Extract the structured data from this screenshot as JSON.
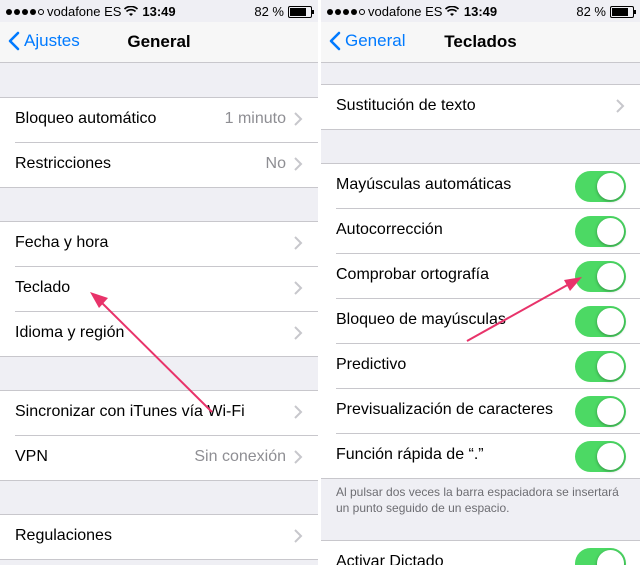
{
  "status_bar": {
    "carrier": "vodafone ES",
    "time": "13:49",
    "battery": "82 %",
    "battery_level_percent": 82
  },
  "left_screen": {
    "nav": {
      "back_label": "Ajustes",
      "title": "General"
    },
    "groups": [
      {
        "rows": [
          {
            "label": "Bloqueo automático",
            "value": "1 minuto"
          },
          {
            "label": "Restricciones",
            "value": "No"
          }
        ]
      },
      {
        "rows": [
          {
            "label": "Fecha y hora",
            "value": ""
          },
          {
            "label": "Teclado",
            "value": ""
          },
          {
            "label": "Idioma y región",
            "value": ""
          }
        ]
      },
      {
        "rows": [
          {
            "label": "Sincronizar con iTunes vía Wi-Fi",
            "value": ""
          },
          {
            "label": "VPN",
            "value": "Sin conexión"
          }
        ]
      },
      {
        "rows": [
          {
            "label": "Regulaciones",
            "value": ""
          }
        ]
      }
    ]
  },
  "right_screen": {
    "nav": {
      "back_label": "General",
      "title": "Teclados"
    },
    "groups": [
      {
        "rows": [
          {
            "label": "Sustitución de texto"
          }
        ]
      },
      {
        "rows": [
          {
            "label": "Mayúsculas automáticas",
            "on": true
          },
          {
            "label": "Autocorrección",
            "on": true
          },
          {
            "label": "Comprobar ortografía",
            "on": true
          },
          {
            "label": "Bloqueo de mayúsculas",
            "on": true
          },
          {
            "label": "Predictivo",
            "on": true
          },
          {
            "label": "Previsualización de caracteres",
            "on": true
          },
          {
            "label": "Función rápida de “.”",
            "on": true
          }
        ]
      },
      {
        "rows": [
          {
            "label": "Activar Dictado",
            "on": true
          }
        ]
      }
    ],
    "footer_note": "Al pulsar dos veces la barra espaciadora se insertará un punto seguido de un espacio."
  },
  "colors": {
    "accent": "#007aff",
    "toggle_on": "#4cd964",
    "annotation_arrow": "#e8336a",
    "background": "#efeff4"
  }
}
